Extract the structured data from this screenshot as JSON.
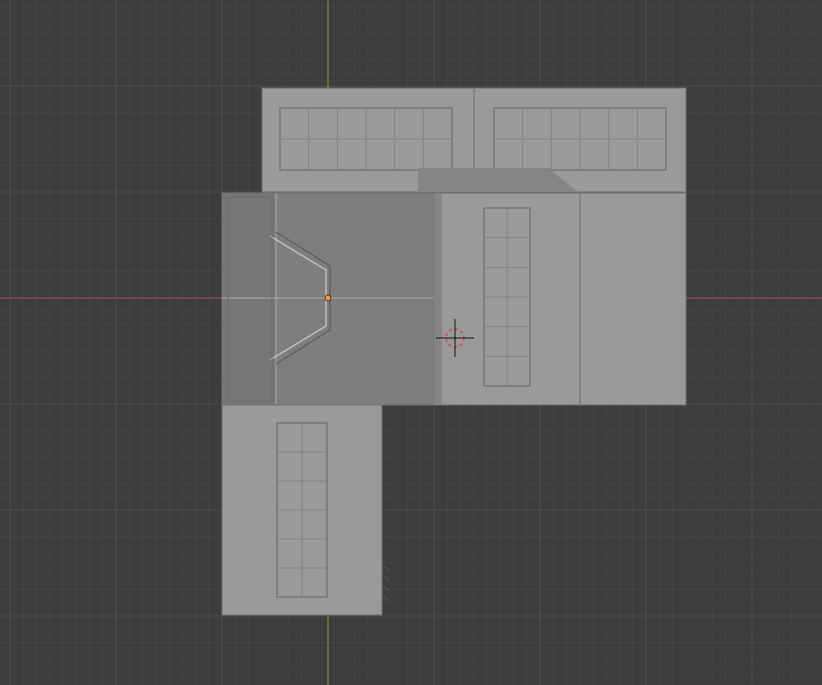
{
  "viewport": {
    "view": "top-orthographic",
    "background_color": "#3d3d3d",
    "grid_minor_color": "#444444",
    "grid_major_color": "#4a4a4a",
    "x_axis_color": "#a8494f",
    "y_axis_color": "#6e9a2a"
  },
  "scene": {
    "mesh_color": "#9a9a9a",
    "mesh_shadow_color": "#858585",
    "mesh_edge_color": "#6e6e6e",
    "origin_color": "#ff9a1f",
    "cursor_color": "#d9473f"
  },
  "objects": [
    {
      "id": "top-left-panel",
      "type": "window-panel",
      "grid": "6x2"
    },
    {
      "id": "top-right-panel",
      "type": "window-panel",
      "grid": "6x2"
    },
    {
      "id": "door-block",
      "type": "door-panel"
    },
    {
      "id": "middle-right-panel",
      "type": "window-panel",
      "grid": "2x6"
    },
    {
      "id": "right-block",
      "type": "plain-block"
    },
    {
      "id": "bottom-panel",
      "type": "window-panel",
      "grid": "2x6"
    }
  ]
}
